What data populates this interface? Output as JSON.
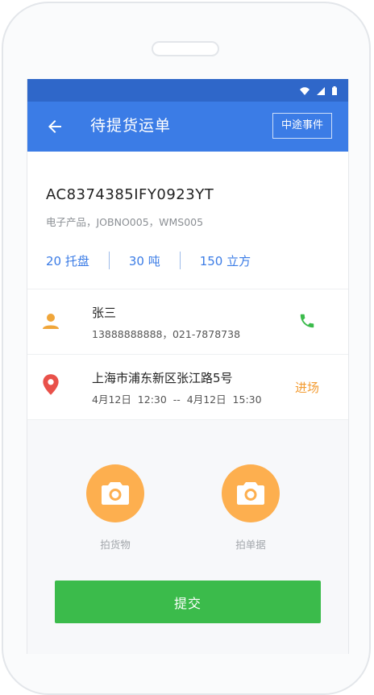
{
  "header": {
    "title": "待提货运单",
    "event_button": "中途事件"
  },
  "order": {
    "number": "AC8374385IFY0923YT",
    "description": "电子产品，JOBNO005，WMS005",
    "stats": [
      "20 托盘",
      "30 吨",
      "150 立方"
    ]
  },
  "contact": {
    "name": "张三",
    "phones": "13888888888，021-7878738"
  },
  "location": {
    "address": "上海市浦东新区张江路5号",
    "time_range": "4月12日  12:30  --  4月12日  15:30",
    "action": "进场"
  },
  "photos": {
    "goods_label": "拍货物",
    "document_label": "拍单据"
  },
  "submit_label": "提交",
  "colors": {
    "status_bar": "#2f67c9",
    "app_bar": "#3b7ce6",
    "accent_blue": "#3b7ce6",
    "orange": "#fdaf4f",
    "green": "#3bbb4b",
    "red_pin": "#e9514a"
  },
  "icons": [
    "back-arrow-icon",
    "wifi-icon",
    "signal-icon",
    "battery-icon",
    "person-icon",
    "phone-icon",
    "location-pin-icon",
    "camera-icon"
  ]
}
